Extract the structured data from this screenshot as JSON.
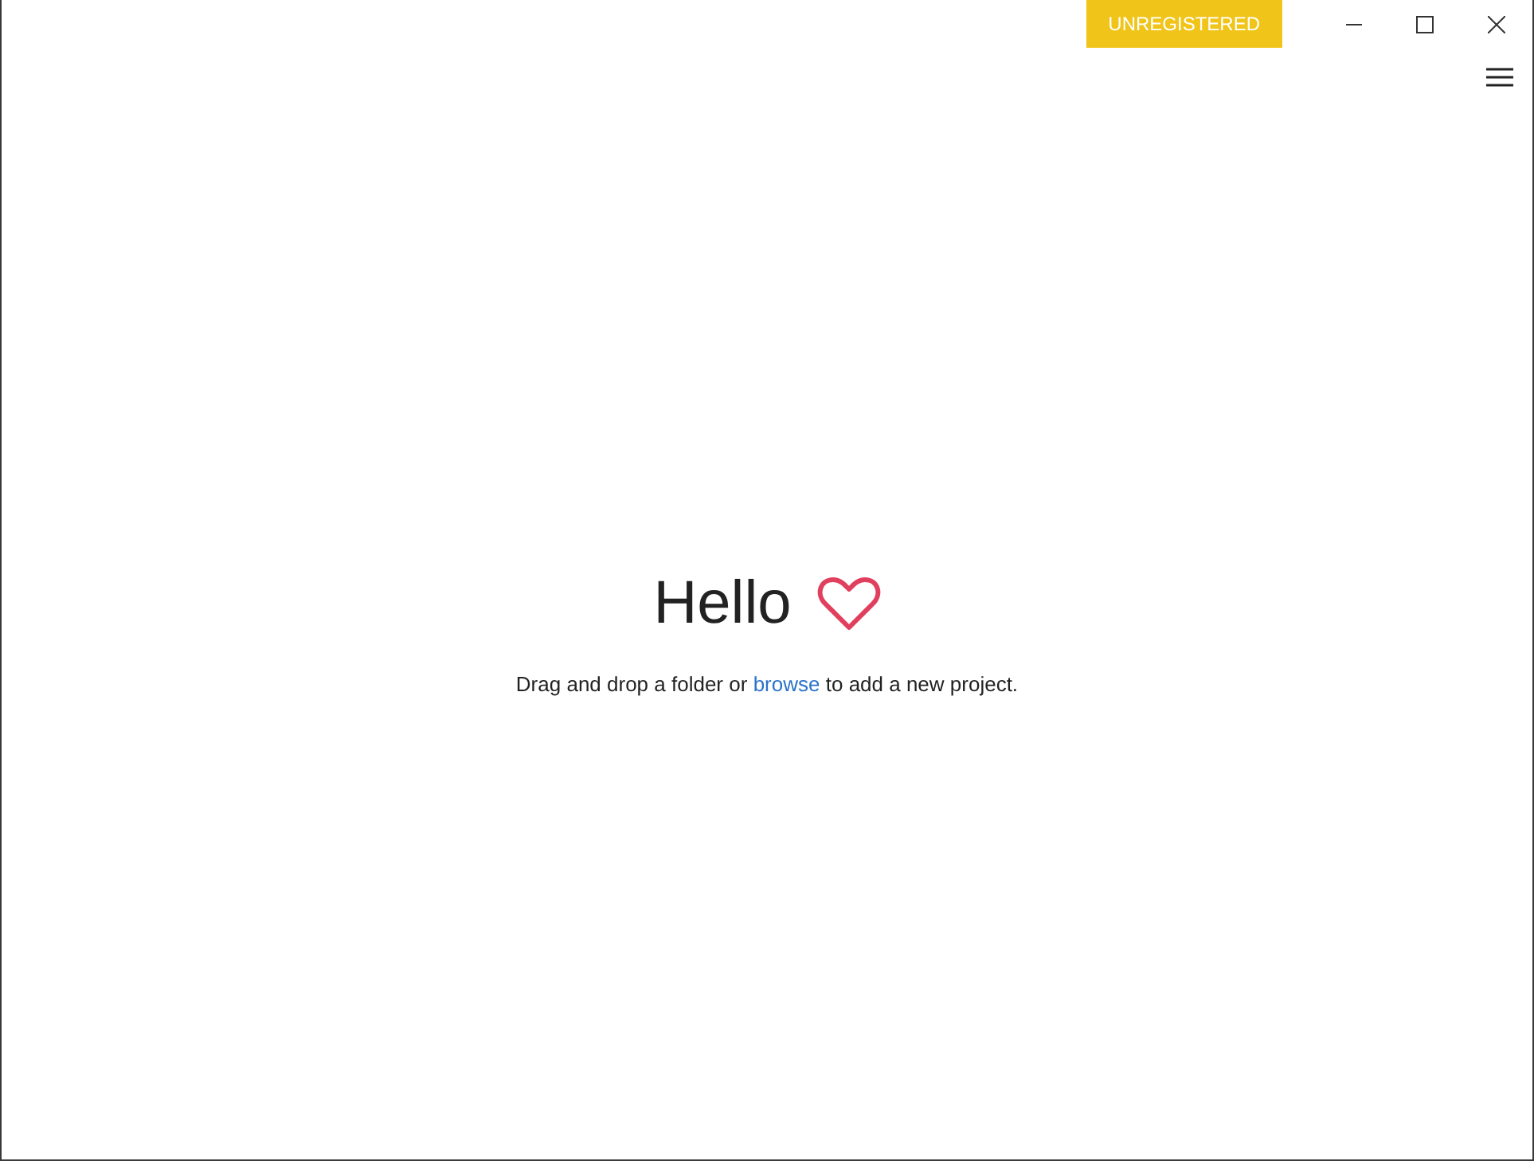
{
  "titlebar": {
    "badge": "UNREGISTERED"
  },
  "welcome": {
    "title": "Hello",
    "hint_before": "Drag and drop a folder or",
    "hint_link": "browse",
    "hint_after": "to add a new project."
  }
}
